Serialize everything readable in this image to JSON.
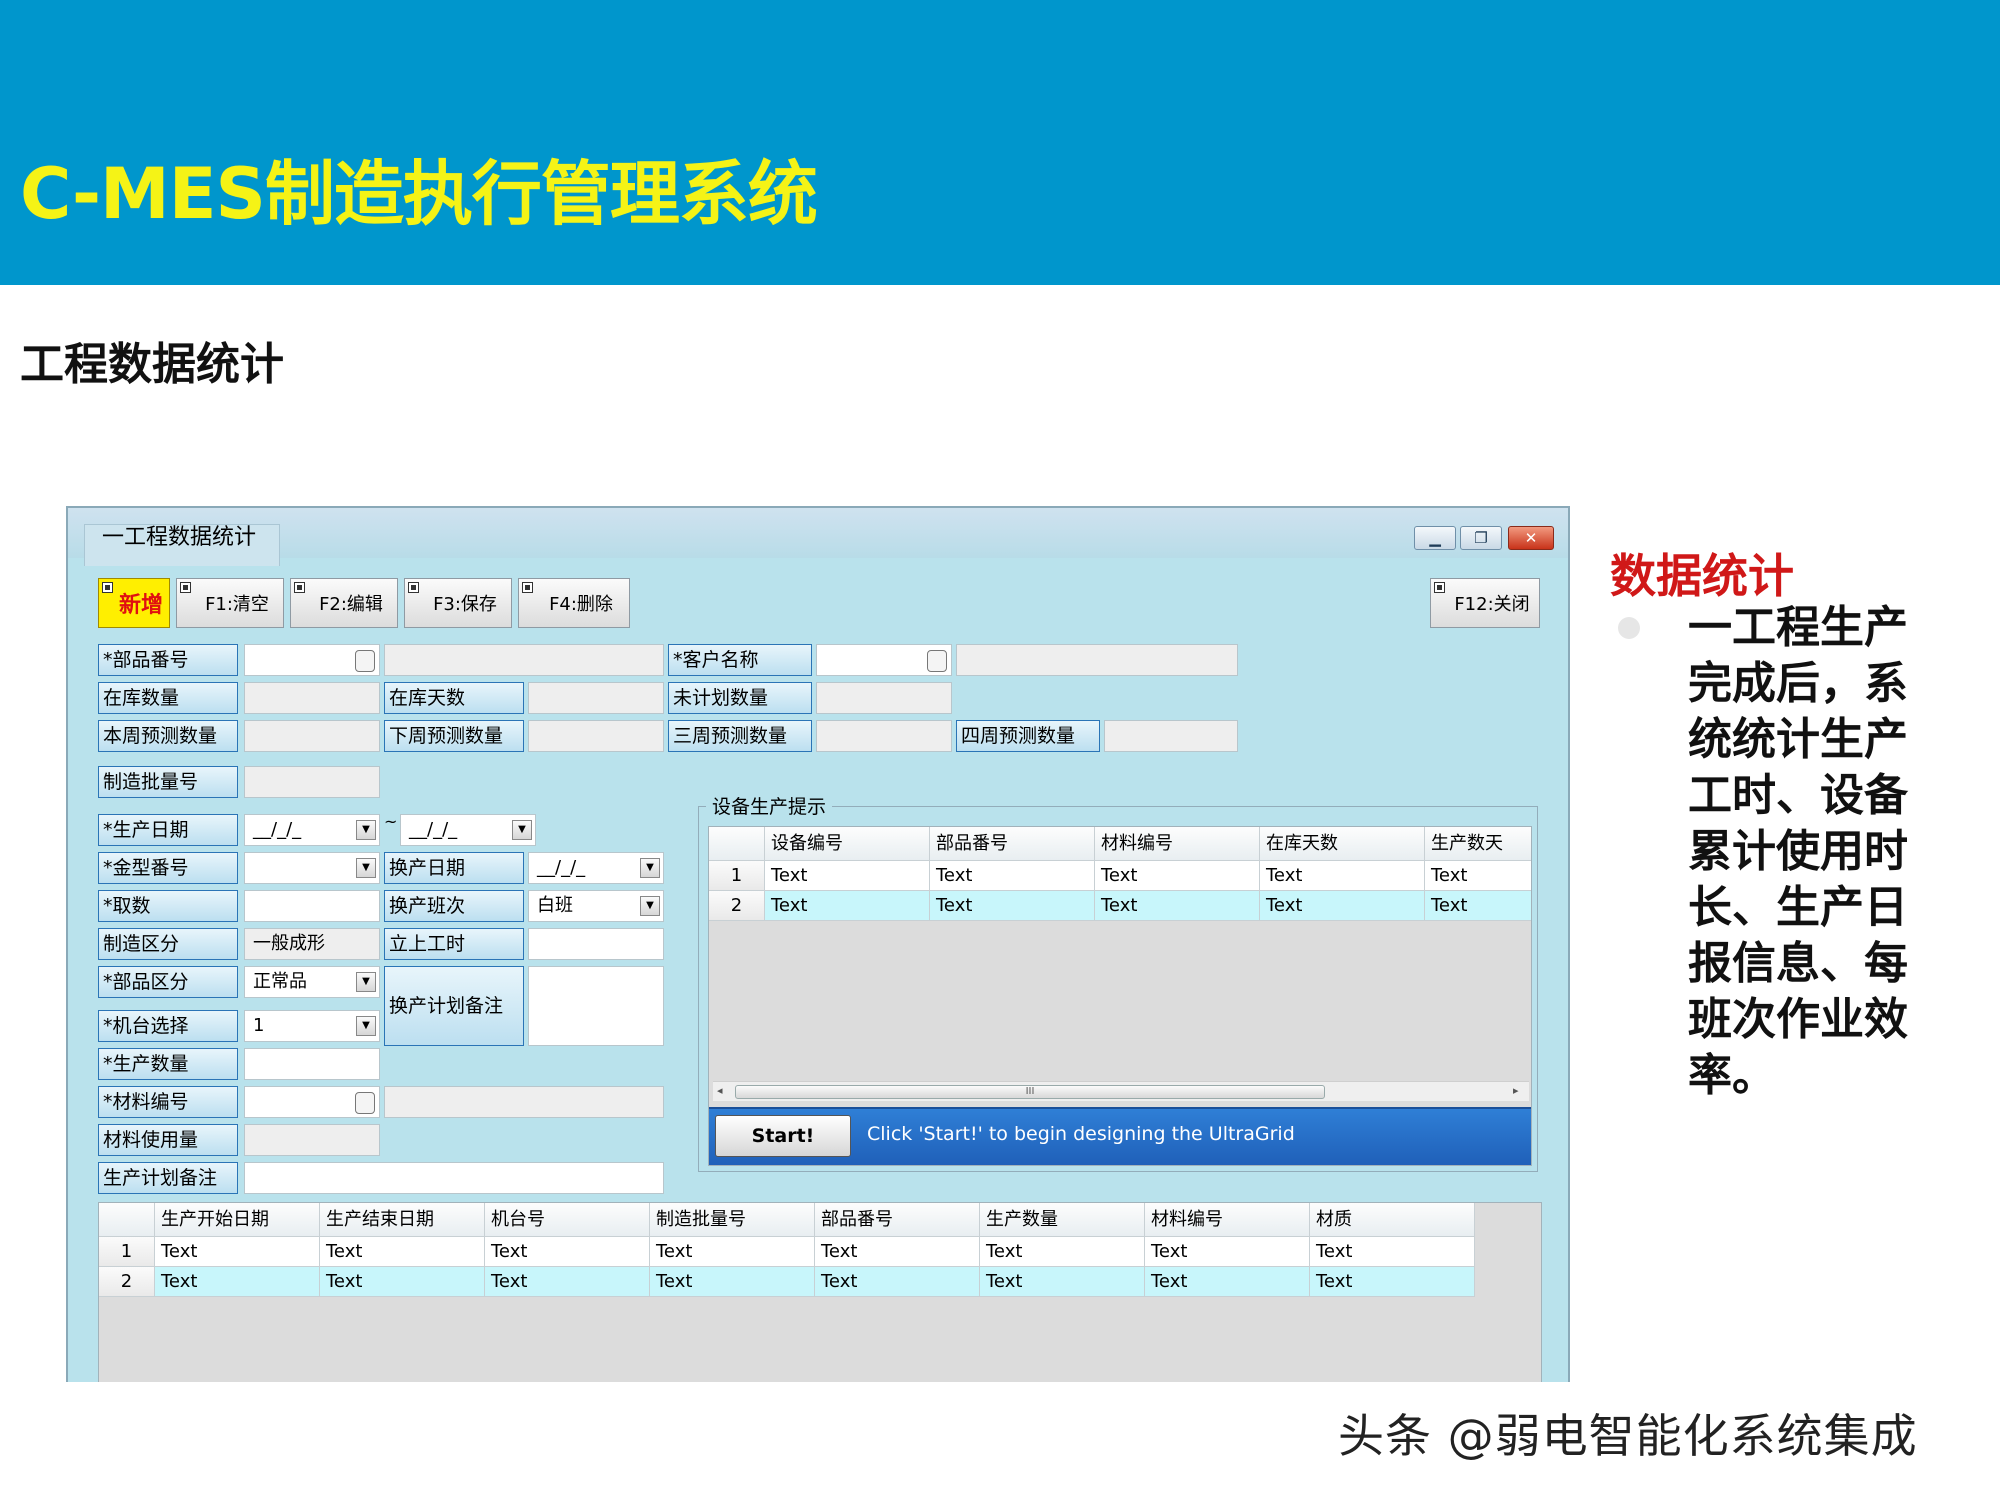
{
  "slide": {
    "title": "C-MES制造执行管理系统",
    "section": "工程数据统计",
    "side_heading": "数据统计",
    "side_body": "一工程生产完成后，系统统计生产工时、设备累计使用时长、生产日报信息、每班次作业效率。",
    "watermark": "头条 @弱电智能化系统集成"
  },
  "window": {
    "title": "一工程数据统计",
    "min_icon": "▁",
    "max_icon": "❐",
    "close_icon": "✕"
  },
  "toolbar": {
    "new": "新增",
    "f1": "F1:清空",
    "f2": "F2:编辑",
    "f3": "F3:保存",
    "f4": "F4:删除",
    "f12": "F12:关闭"
  },
  "form": {
    "part_no": "*部品番号",
    "customer_name": "*客户名称",
    "stock_qty": "在库数量",
    "stock_days": "在库天数",
    "unplanned_qty": "未计划数量",
    "week_forecast": "本周预测数量",
    "next_week_forecast": "下周预测数量",
    "three_week_forecast": "三周预测数量",
    "four_week_forecast": "四周预测数量",
    "lot_no": "制造批量号",
    "prod_date": "*生产日期",
    "date_placeholder": "__/_/_",
    "tilde": "~",
    "mold_no": "*金型番号",
    "change_date": "换产日期",
    "cavity": "*取数",
    "change_shift": "换产班次",
    "change_shift_value": "白班",
    "mfg_class": "制造区分",
    "mfg_class_value": "一般成形",
    "setup_time": "立上工时",
    "part_class": "*部品区分",
    "part_class_value": "正常品",
    "change_plan_note": "换产计划备注",
    "machine": "*机台选择",
    "machine_value": "1",
    "prod_qty": "*生产数量",
    "material_no": "*材料编号",
    "material_used": "材料使用量",
    "prod_plan_note": "生产计划备注",
    "dropdown_icon": "▼"
  },
  "device_panel": {
    "caption": "设备生产提示",
    "columns": [
      "设备编号",
      "部品番号",
      "材料编号",
      "在库天数",
      "生产数天"
    ],
    "rows": [
      {
        "n": "1",
        "cells": [
          "Text",
          "Text",
          "Text",
          "Text",
          "Text"
        ]
      },
      {
        "n": "2",
        "cells": [
          "Text",
          "Text",
          "Text",
          "Text",
          "Text"
        ]
      }
    ],
    "scroll_thumb": "III",
    "scroll_left": "◂",
    "scroll_right": "▸",
    "start_label": "Start!",
    "start_hint": "Click 'Start!' to begin designing the UltraGrid"
  },
  "plan_grid": {
    "columns": [
      "生产开始日期",
      "生产结束日期",
      "机台号",
      "制造批量号",
      "部品番号",
      "生产数量",
      "材料编号",
      "材质"
    ],
    "rows": [
      {
        "n": "1",
        "cells": [
          "Text",
          "Text",
          "Text",
          "Text",
          "Text",
          "Text",
          "Text",
          "Text"
        ]
      },
      {
        "n": "2",
        "cells": [
          "Text",
          "Text",
          "Text",
          "Text",
          "Text",
          "Text",
          "Text",
          "Text"
        ]
      }
    ]
  }
}
